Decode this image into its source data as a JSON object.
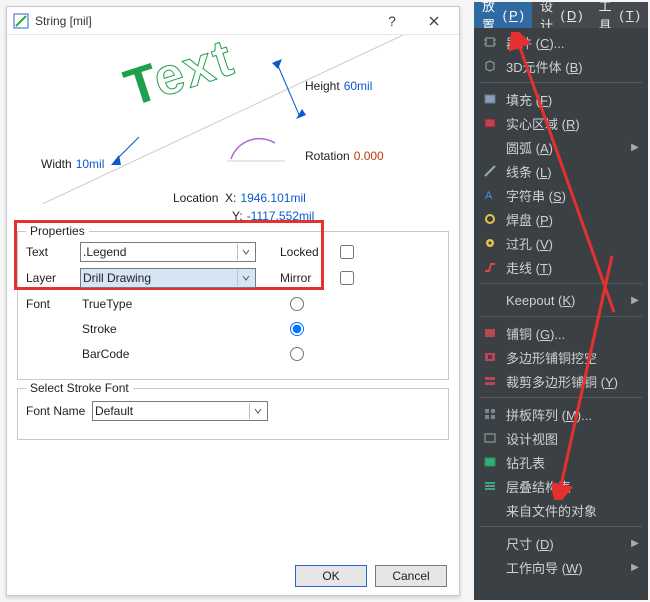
{
  "dialog": {
    "title": "String  [mil]",
    "preview": {
      "height_label": "Height",
      "height_value": "60mil",
      "width_label": "Width",
      "width_value": "10mil",
      "rotation_label": "Rotation",
      "rotation_value": "0.000",
      "location_label": "Location",
      "location_x_label": "X:",
      "location_x_value": "1946.101mil",
      "location_y_label": "Y:",
      "location_y_value": "-1117.552mil"
    },
    "properties": {
      "legend": "Properties",
      "text_label": "Text",
      "text_value": ".Legend",
      "layer_label": "Layer",
      "layer_value": "Drill Drawing",
      "locked_label": "Locked",
      "locked": false,
      "mirror_label": "Mirror",
      "mirror": false,
      "font_label": "Font",
      "font_options": {
        "truetype": "TrueType",
        "stroke": "Stroke",
        "barcode": "BarCode"
      },
      "font_selected": "stroke"
    },
    "stroke_font": {
      "legend": "Select Stroke Font",
      "fontname_label": "Font Name",
      "fontname_value": "Default"
    },
    "buttons": {
      "ok": "OK",
      "cancel": "Cancel"
    }
  },
  "menu": {
    "tabs": {
      "place": "放置",
      "place_accel": "P",
      "design": "设计",
      "design_accel": "D",
      "tools": "工具",
      "tools_accel": "T"
    },
    "items": [
      {
        "id": "component",
        "label": "器件",
        "accel": "C",
        "ellipsis": true,
        "sub": false,
        "icon": "cpu"
      },
      {
        "id": "3dbody",
        "label": "3D元件体",
        "accel": "B",
        "ellipsis": false,
        "sub": false,
        "icon": "body3d"
      },
      {
        "sep": true
      },
      {
        "id": "fill",
        "label": "填充",
        "accel": "F",
        "ellipsis": false,
        "sub": false,
        "icon": "fill"
      },
      {
        "id": "solidregion",
        "label": "实心区域",
        "accel": "R",
        "ellipsis": false,
        "sub": false,
        "icon": "region"
      },
      {
        "id": "arc",
        "label": "圆弧",
        "accel": "A",
        "ellipsis": false,
        "sub": true,
        "icon": ""
      },
      {
        "id": "line",
        "label": "线条",
        "accel": "L",
        "ellipsis": false,
        "sub": false,
        "icon": "line"
      },
      {
        "id": "string",
        "label": "字符串",
        "accel": "S",
        "ellipsis": false,
        "sub": false,
        "icon": "text"
      },
      {
        "id": "pad",
        "label": "焊盘",
        "accel": "P",
        "ellipsis": false,
        "sub": false,
        "icon": "pad"
      },
      {
        "id": "via",
        "label": "过孔",
        "accel": "V",
        "ellipsis": false,
        "sub": false,
        "icon": "via"
      },
      {
        "id": "track",
        "label": "走线",
        "accel": "T",
        "ellipsis": false,
        "sub": false,
        "icon": "track"
      },
      {
        "sep": true
      },
      {
        "id": "keepout",
        "label": "Keepout",
        "accel": "K",
        "ellipsis": false,
        "sub": true,
        "icon": ""
      },
      {
        "sep": true
      },
      {
        "id": "polygon",
        "label": "铺铜",
        "accel": "G",
        "ellipsis": true,
        "sub": false,
        "icon": "poly"
      },
      {
        "id": "polycut",
        "label": "多边形铺铜挖空",
        "accel": "",
        "ellipsis": false,
        "sub": false,
        "icon": "polycut"
      },
      {
        "id": "polyslice",
        "label": "裁剪多边形铺铜",
        "accel": "Y",
        "ellipsis": false,
        "sub": false,
        "icon": "polyslice"
      },
      {
        "sep": true
      },
      {
        "id": "embarr",
        "label": "拼板阵列",
        "accel": "M",
        "ellipsis": true,
        "sub": false,
        "icon": "grid"
      },
      {
        "id": "designview",
        "label": "设计视图",
        "accel": "",
        "ellipsis": false,
        "sub": false,
        "icon": "view"
      },
      {
        "id": "drilltable",
        "label": "钻孔表",
        "accel": "",
        "ellipsis": false,
        "sub": false,
        "icon": "drill"
      },
      {
        "id": "stack",
        "label": "层叠结构表",
        "accel": "",
        "ellipsis": false,
        "sub": false,
        "icon": "stack"
      },
      {
        "id": "fromfile",
        "label": "来自文件的对象",
        "accel": "",
        "ellipsis": false,
        "sub": false,
        "icon": ""
      },
      {
        "sep": true
      },
      {
        "id": "dimension",
        "label": "尺寸",
        "accel": "D",
        "ellipsis": false,
        "sub": true,
        "icon": ""
      },
      {
        "id": "workguides",
        "label": "工作向导",
        "accel": "W",
        "ellipsis": false,
        "sub": true,
        "icon": ""
      }
    ]
  }
}
